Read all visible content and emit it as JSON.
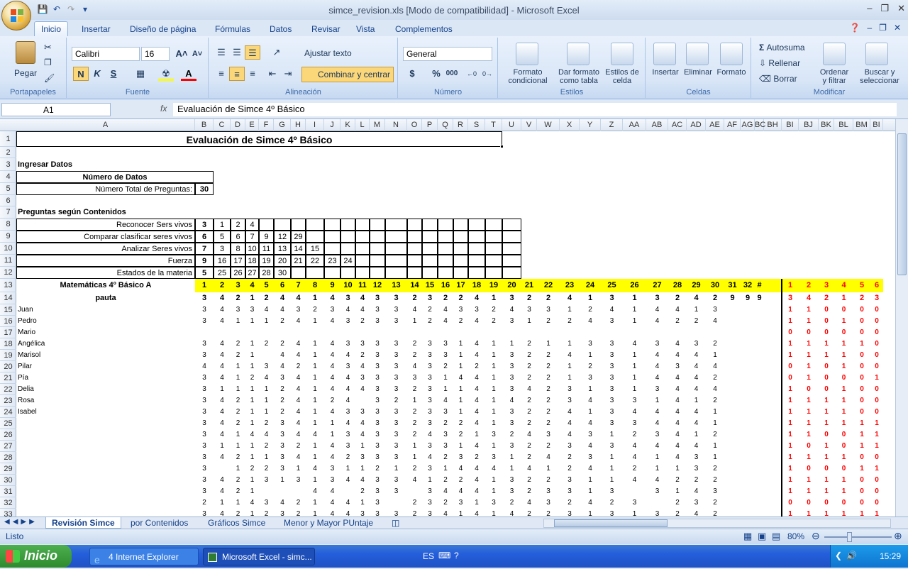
{
  "window": {
    "title": "simce_revision.xls  [Modo de compatibilidad] - Microsoft Excel"
  },
  "ribbon_tabs": [
    "Inicio",
    "Insertar",
    "Diseño de página",
    "Fórmulas",
    "Datos",
    "Revisar",
    "Vista",
    "Complementos"
  ],
  "ribbon": {
    "paste": "Pegar",
    "clipboard_group": "Portapapeles",
    "font_name": "Calibri",
    "font_size": "16",
    "font_group": "Fuente",
    "bold": "N",
    "italic": "K",
    "underline": "S",
    "wrap_text": "Ajustar texto",
    "merge_center": "Combinar y centrar",
    "alignment_group": "Alineación",
    "number_format": "General",
    "currency": "$",
    "percent": "%",
    "thousands": "000",
    "number_group": "Número",
    "cond_format_1": "Formato",
    "cond_format_2": "condicional",
    "table_format_1": "Dar formato",
    "table_format_2": "como tabla",
    "cell_styles_1": "Estilos de",
    "cell_styles_2": "celda",
    "styles_group": "Estilos",
    "insert": "Insertar",
    "delete": "Eliminar",
    "format": "Formato",
    "cells_group": "Celdas",
    "autosum": "Autosuma",
    "fill": "Rellenar",
    "clear": "Borrar",
    "sort_1": "Ordenar",
    "sort_2": "y filtrar",
    "find_1": "Buscar y",
    "find_2": "seleccionar",
    "modify_group": "Modificar"
  },
  "formula_bar": {
    "name_box": "A1",
    "fx": "fx",
    "content": "Evaluación de Simce 4º Básico"
  },
  "columns": [
    "A",
    "B",
    "C",
    "D",
    "E",
    "F",
    "G",
    "H",
    "I",
    "J",
    "K",
    "L",
    "M",
    "N",
    "O",
    "P",
    "Q",
    "R",
    "S",
    "T",
    "U",
    "V",
    "W",
    "X",
    "Y",
    "Z",
    "AA",
    "AB",
    "AC",
    "AD",
    "AE",
    "AF",
    "AG",
    "BC",
    "BH",
    "BI",
    "BJ",
    "BK",
    "BL",
    "BM",
    "BI"
  ],
  "rows": [
    "1",
    "2",
    "3",
    "4",
    "5",
    "6",
    "7",
    "8",
    "9",
    "10",
    "11",
    "12",
    "13",
    "14",
    "15",
    "16",
    "17",
    "18",
    "19",
    "20",
    "21",
    "22",
    "23",
    "24",
    "25",
    "26",
    "27",
    "28",
    "29",
    "30",
    "31",
    "32",
    "33"
  ],
  "sheet": {
    "title": "Evaluación de Simce 4º Básico",
    "ingresar": "Ingresar Datos",
    "num_datos": "Número de Datos",
    "total_preg_label": "Número Total de Preguntas:",
    "total_preg": "30",
    "preg_contenidos": "Preguntas según Contenidos",
    "content_rows": [
      {
        "label": "Reconocer  Sers vivos",
        "n": "3",
        "items": [
          "1",
          "2",
          "4"
        ]
      },
      {
        "label": "Comparar clasificar seres vivos",
        "n": "6",
        "items": [
          "5",
          "6",
          "7",
          "9",
          "12",
          "29"
        ]
      },
      {
        "label": "Analizar  Seres vivos",
        "n": "7",
        "items": [
          "3",
          "8",
          "10",
          "11",
          "13",
          "14",
          "15"
        ]
      },
      {
        "label": "Fuerza",
        "n": "9",
        "items": [
          "16",
          "17",
          "18",
          "19",
          "20",
          "21",
          "22",
          "23",
          "24"
        ]
      },
      {
        "label": "Estados de la materia",
        "n": "5",
        "items": [
          "25",
          "26",
          "27",
          "28",
          "30"
        ]
      }
    ],
    "header13_label": "Matemáticas 4º Básico A",
    "header13": [
      "1",
      "2",
      "3",
      "4",
      "5",
      "6",
      "7",
      "8",
      "9",
      "10",
      "11",
      "12",
      "13",
      "14",
      "15",
      "16",
      "17",
      "18",
      "19",
      "20",
      "21",
      "22",
      "23",
      "24",
      "25",
      "26",
      "27",
      "28",
      "29",
      "30",
      "31",
      "32",
      "#"
    ],
    "header13_right": [
      "1",
      "2",
      "3",
      "4",
      "5",
      "6"
    ],
    "pauta_label": "pauta",
    "pauta": [
      "3",
      "4",
      "2",
      "1",
      "2",
      "4",
      "4",
      "1",
      "4",
      "3",
      "4",
      "3",
      "3",
      "2",
      "3",
      "2",
      "2",
      "4",
      "1",
      "3",
      "2",
      "2",
      "4",
      "1",
      "3",
      "1",
      "3",
      "2",
      "4",
      "2",
      "9",
      "9",
      "9"
    ],
    "pauta_right": [
      "3",
      "4",
      "2",
      "1",
      "2",
      "3"
    ],
    "students": [
      {
        "name": "Juan",
        "v": [
          "3",
          "4",
          "3",
          "3",
          "4",
          "4",
          "3",
          "2",
          "3",
          "4",
          "4",
          "3",
          "3",
          "4",
          "2",
          "4",
          "3",
          "3",
          "2",
          "4",
          "3",
          "3",
          "1",
          "2",
          "4",
          "1",
          "4",
          "4",
          "1",
          "3"
        ],
        "r": [
          "1",
          "1",
          "0",
          "0",
          "0",
          "0"
        ]
      },
      {
        "name": "Pedro",
        "v": [
          "3",
          "4",
          "1",
          "1",
          "1",
          "2",
          "4",
          "1",
          "4",
          "3",
          "2",
          "3",
          "3",
          "1",
          "2",
          "4",
          "2",
          "4",
          "2",
          "3",
          "1",
          "2",
          "2",
          "4",
          "3",
          "1",
          "4",
          "2",
          "2",
          "4"
        ],
        "r": [
          "1",
          "1",
          "0",
          "1",
          "0",
          "0"
        ]
      },
      {
        "name": "Mario",
        "v": [],
        "r": [
          "0",
          "0",
          "0",
          "0",
          "0",
          "0"
        ]
      },
      {
        "name": "Angélica",
        "v": [
          "3",
          "4",
          "2",
          "1",
          "2",
          "2",
          "4",
          "1",
          "4",
          "3",
          "3",
          "3",
          "3",
          "2",
          "3",
          "3",
          "1",
          "4",
          "1",
          "1",
          "2",
          "1",
          "1",
          "3",
          "3",
          "4",
          "3",
          "4",
          "3",
          "2"
        ],
        "r": [
          "1",
          "1",
          "1",
          "1",
          "1",
          "0"
        ]
      },
      {
        "name": "Marisol",
        "v": [
          "3",
          "4",
          "2",
          "1",
          "",
          "4",
          "4",
          "1",
          "4",
          "4",
          "2",
          "3",
          "3",
          "2",
          "3",
          "3",
          "1",
          "4",
          "1",
          "3",
          "2",
          "2",
          "4",
          "1",
          "3",
          "1",
          "4",
          "4",
          "4",
          "1"
        ],
        "r": [
          "1",
          "1",
          "1",
          "1",
          "0",
          "0"
        ]
      },
      {
        "name": "Pilar",
        "v": [
          "4",
          "4",
          "1",
          "1",
          "3",
          "4",
          "2",
          "1",
          "4",
          "3",
          "4",
          "3",
          "3",
          "4",
          "3",
          "2",
          "1",
          "2",
          "1",
          "3",
          "2",
          "2",
          "1",
          "2",
          "3",
          "1",
          "4",
          "3",
          "4",
          "4"
        ],
        "r": [
          "0",
          "1",
          "0",
          "1",
          "0",
          "0"
        ]
      },
      {
        "name": "Pía",
        "v": [
          "3",
          "4",
          "1",
          "2",
          "4",
          "3",
          "4",
          "1",
          "4",
          "4",
          "3",
          "3",
          "3",
          "3",
          "3",
          "1",
          "4",
          "4",
          "1",
          "3",
          "2",
          "2",
          "1",
          "3",
          "3",
          "1",
          "4",
          "4",
          "4",
          "2"
        ],
        "r": [
          "0",
          "1",
          "0",
          "0",
          "0",
          "1"
        ]
      },
      {
        "name": "Delia",
        "v": [
          "3",
          "1",
          "1",
          "1",
          "1",
          "2",
          "4",
          "1",
          "4",
          "4",
          "4",
          "3",
          "3",
          "2",
          "3",
          "1",
          "1",
          "4",
          "1",
          "3",
          "4",
          "2",
          "3",
          "1",
          "3",
          "1",
          "3",
          "4",
          "4",
          "4"
        ],
        "r": [
          "1",
          "0",
          "0",
          "1",
          "0",
          "0"
        ]
      },
      {
        "name": "Rosa",
        "v": [
          "3",
          "4",
          "2",
          "1",
          "1",
          "2",
          "4",
          "1",
          "2",
          "4",
          "",
          "3",
          "2",
          "1",
          "3",
          "4",
          "1",
          "4",
          "1",
          "4",
          "2",
          "2",
          "3",
          "4",
          "3",
          "3",
          "1",
          "4",
          "1",
          "2"
        ],
        "r": [
          "1",
          "1",
          "1",
          "1",
          "0",
          "0"
        ]
      },
      {
        "name": "Isabel",
        "v": [
          "3",
          "4",
          "2",
          "1",
          "1",
          "2",
          "4",
          "1",
          "4",
          "3",
          "3",
          "3",
          "3",
          "2",
          "3",
          "3",
          "1",
          "4",
          "1",
          "3",
          "2",
          "2",
          "4",
          "1",
          "3",
          "4",
          "4",
          "4",
          "4",
          "1"
        ],
        "r": [
          "1",
          "1",
          "1",
          "1",
          "0",
          "0"
        ]
      },
      {
        "name": "",
        "v": [
          "3",
          "4",
          "2",
          "1",
          "2",
          "3",
          "4",
          "1",
          "1",
          "4",
          "4",
          "3",
          "3",
          "2",
          "3",
          "2",
          "2",
          "4",
          "1",
          "3",
          "2",
          "2",
          "4",
          "4",
          "3",
          "3",
          "4",
          "4",
          "4",
          "1"
        ],
        "r": [
          "1",
          "1",
          "1",
          "1",
          "1",
          "1"
        ]
      },
      {
        "name": "",
        "v": [
          "3",
          "4",
          "1",
          "4",
          "4",
          "3",
          "4",
          "4",
          "1",
          "3",
          "4",
          "3",
          "3",
          "2",
          "4",
          "3",
          "2",
          "1",
          "3",
          "2",
          "4",
          "3",
          "4",
          "3",
          "1",
          "2",
          "3",
          "4",
          "1",
          "2"
        ],
        "r": [
          "1",
          "1",
          "0",
          "0",
          "1",
          "1"
        ]
      },
      {
        "name": "",
        "v": [
          "3",
          "1",
          "1",
          "1",
          "2",
          "3",
          "2",
          "1",
          "4",
          "3",
          "1",
          "3",
          "3",
          "1",
          "3",
          "3",
          "1",
          "4",
          "1",
          "3",
          "2",
          "2",
          "3",
          "4",
          "3",
          "4",
          "4",
          "4",
          "4",
          "1"
        ],
        "r": [
          "1",
          "0",
          "1",
          "0",
          "1",
          "1"
        ]
      },
      {
        "name": "",
        "v": [
          "3",
          "4",
          "2",
          "1",
          "1",
          "3",
          "4",
          "1",
          "4",
          "2",
          "3",
          "3",
          "3",
          "1",
          "4",
          "2",
          "3",
          "2",
          "3",
          "1",
          "2",
          "4",
          "2",
          "3",
          "1",
          "4",
          "1",
          "4",
          "3",
          "1"
        ],
        "r": [
          "1",
          "1",
          "1",
          "1",
          "0",
          "0"
        ]
      },
      {
        "name": "",
        "v": [
          "3",
          "",
          "1",
          "2",
          "2",
          "3",
          "1",
          "4",
          "3",
          "1",
          "1",
          "2",
          "1",
          "2",
          "3",
          "1",
          "4",
          "4",
          "4",
          "1",
          "4",
          "1",
          "2",
          "4",
          "1",
          "2",
          "1",
          "1",
          "3",
          "2"
        ],
        "r": [
          "1",
          "0",
          "0",
          "0",
          "1",
          "1"
        ]
      },
      {
        "name": "",
        "v": [
          "3",
          "4",
          "2",
          "1",
          "3",
          "1",
          "3",
          "1",
          "3",
          "4",
          "4",
          "3",
          "3",
          "4",
          "1",
          "2",
          "2",
          "4",
          "1",
          "3",
          "2",
          "2",
          "3",
          "1",
          "1",
          "4",
          "4",
          "2",
          "2",
          "2"
        ],
        "r": [
          "1",
          "1",
          "1",
          "1",
          "0",
          "0"
        ]
      },
      {
        "name": "",
        "v": [
          "3",
          "4",
          "2",
          "1",
          "",
          "",
          "",
          "4",
          "4",
          "",
          "2",
          "3",
          "3",
          "",
          "3",
          "4",
          "4",
          "4",
          "1",
          "3",
          "2",
          "3",
          "3",
          "1",
          "3",
          "",
          "3",
          "1",
          "4",
          "3"
        ],
        "r": [
          "1",
          "1",
          "1",
          "1",
          "0",
          "0"
        ]
      },
      {
        "name": "",
        "v": [
          "2",
          "1",
          "1",
          "4",
          "3",
          "4",
          "2",
          "1",
          "4",
          "4",
          "1",
          "3",
          "",
          "2",
          "3",
          "2",
          "3",
          "1",
          "3",
          "2",
          "4",
          "3",
          "2",
          "4",
          "2",
          "3",
          "",
          "2",
          "3",
          "2"
        ],
        "r": [
          "0",
          "0",
          "0",
          "0",
          "0",
          "0"
        ]
      },
      {
        "name": "",
        "v": [
          "3",
          "4",
          "2",
          "1",
          "2",
          "3",
          "2",
          "1",
          "4",
          "4",
          "3",
          "3",
          "3",
          "2",
          "3",
          "4",
          "1",
          "4",
          "1",
          "4",
          "2",
          "2",
          "3",
          "1",
          "3",
          "1",
          "3",
          "2",
          "4",
          "2"
        ],
        "r": [
          "1",
          "1",
          "1",
          "1",
          "1",
          "1"
        ]
      }
    ]
  },
  "sheet_tabs": [
    "Revisión Simce",
    "por Contenidos",
    "Gráficos Simce",
    "Menor y Mayor PUntaje"
  ],
  "status": {
    "ready": "Listo",
    "zoom": "80%"
  },
  "taskbar": {
    "start": "Inicio",
    "ie": "4 Internet Explorer",
    "excel": "Microsoft Excel - simc...",
    "lang": "ES",
    "time": "15:29"
  },
  "colors": {
    "yellow": "#ffff00",
    "red": "#ff0000",
    "ribbon_blue": "#15428b"
  }
}
